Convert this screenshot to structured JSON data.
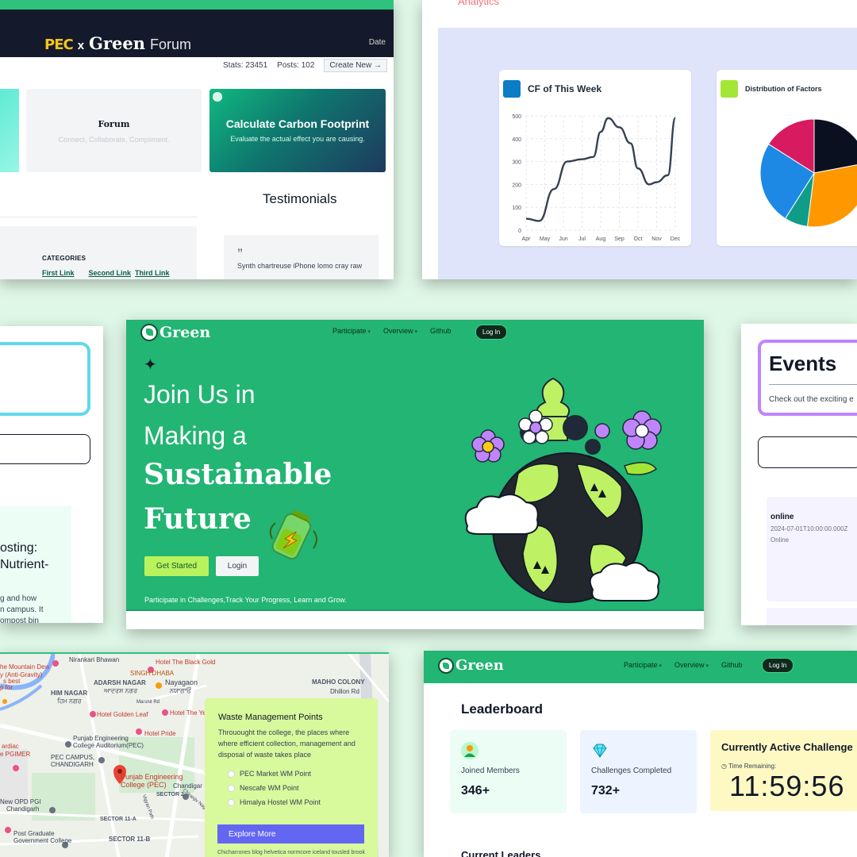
{
  "forum": {
    "brand_pec": "PEC",
    "brand_x": "x",
    "brand_green": "Green",
    "brand_forum": "Forum",
    "date_label": "Date",
    "stats": "Stats: 23451",
    "posts": "Posts: 102",
    "create_new": "Create New →",
    "tile_forum_title": "Forum",
    "tile_forum_sub": "Connect, Collaborate, Compliment.",
    "tile_cf_title": "Calculate Carbon Footprint",
    "tile_cf_sub": "Evaluate the actual effect you are causing.",
    "testimonials": "Testimonials",
    "quote_mark": "”",
    "quote_text": "Synth chartreuse iPhone lomo cray raw",
    "categories_title": "CATEGORIES",
    "links": [
      "First Link",
      "Second Link",
      "Third Link"
    ]
  },
  "analytics": {
    "title": "Analytics",
    "cf_title": "CF of This Week",
    "dist_title": "Distribution of Factors",
    "colors": {
      "cf_square": "#0b7dc6",
      "dist_square": "#a3e635"
    }
  },
  "chart_data": [
    {
      "type": "line",
      "title": "CF of This Week",
      "categories": [
        "Apr",
        "May",
        "Jun",
        "Jul",
        "Aug",
        "Sep",
        "Oct",
        "Nov",
        "Dec"
      ],
      "x_points": [
        4,
        4.7,
        5.5,
        6.2,
        7.0,
        7.6,
        8.0,
        8.4,
        9.0,
        9.6,
        10.0,
        10.6,
        11.0,
        11.6,
        12.0
      ],
      "values": [
        50,
        40,
        180,
        300,
        310,
        320,
        430,
        490,
        450,
        380,
        270,
        200,
        210,
        240,
        490
      ],
      "ylim": [
        0,
        500
      ],
      "yticks": [
        0,
        100,
        200,
        300,
        400,
        500
      ],
      "grid": true
    },
    {
      "type": "pie",
      "title": "Distribution of Factors",
      "values": [
        22,
        30,
        7,
        25,
        16
      ],
      "colors": [
        "#0b1020",
        "#ff9800",
        "#0f9d8a",
        "#1e88e5",
        "#d81b60"
      ]
    }
  ],
  "leftmid": {
    "article_title_1": "osting:",
    "article_title_2": "Nutrient-",
    "article_text_1": "g and how",
    "article_text_2": "n campus. It",
    "article_text_3": "ompost bin"
  },
  "hero": {
    "logo_text": "Green",
    "menu": [
      "Participate",
      "Overview",
      "Github"
    ],
    "login": "Log In",
    "line1": "Join Us in",
    "line2": "Making a",
    "line3": "Sustainable",
    "line4": "Future",
    "get_started": "Get Started",
    "login_button": "Login",
    "tagline": "Participate in Challenges,Track Your Progress, Learn and Grow."
  },
  "events": {
    "title": "Events",
    "subtitle": "Check out the exciting e",
    "item_title": "online",
    "item_date": "2024-07-01T10:00:00.000Z",
    "item_mode": "Online"
  },
  "map": {
    "labels": {
      "mountain": "he Mountain Dew",
      "antigravity": "y (Anti-Gravity)",
      "best": "s best",
      "pgimer_top": "p for",
      "nirankari": "Nirankari Bhawan",
      "blackgold": "Hotel The Black Gold",
      "singh": "SINGH DHABA",
      "adarsh": "ADARSH NAGAR",
      "adarsh_pa": "ਆਦਰਸ਼ ਨਗਰ",
      "nayagaon": "Nayagaon",
      "nayagaon_pa": "ਨਯਾਗਾਓਂ",
      "madho": "MADHO COLONY",
      "dhillon": "Dhillon Rd",
      "him": "HIM NAGAR",
      "him_pa": "ਹਿਮ ਨਗਰ",
      "marshit": "Marshit Rd",
      "golden": "Hotel Golden Leaf",
      "yell": "Hotel The Yell",
      "pride": "Hotel Pride",
      "auditorium1": "Punjab Engineering",
      "auditorium2": "College Auditorium(PEC)",
      "cardiac": "ardiac",
      "pgimer": "e PGIMER",
      "campus1": "PEC CAMPUS,",
      "campus2": "CHANDIGARH",
      "pec1": "Punjab Engineering",
      "pec2": "College (PEC)",
      "chandigar": "Chandigar",
      "sector2": "SECTOR 2",
      "opd1": "New OPD PGI",
      "opd2": "Chandigarh",
      "sector11a": "SECTOR 11-A",
      "sector11b": "SECTOR 11-B",
      "postgrad1": "Post Graduate",
      "postgrad2": "Government College",
      "vigyan": "Vigyan Path",
      "chiranjiv": "Chiranjiv Nagar"
    },
    "panel_title": "Waste Management Points",
    "panel_desc": "Throuought the college, the places where where efficient collection, management and disposal of waste takes place",
    "points": [
      "PEC Market WM Point",
      "Nescafe WM Point",
      "Himalya Hostel WM Point"
    ],
    "explore": "Explore More",
    "foot": "Chicharrones blog helvetica normcore iceland tousled brook"
  },
  "leader": {
    "logo_text": "Green",
    "menu": [
      "Participate",
      "Overview",
      "Github"
    ],
    "login": "Log In",
    "title": "Leaderboard",
    "joined_label": "Joined Members",
    "joined_value": "346+",
    "completed_label": "Challenges Completed",
    "completed_value": "732+",
    "active_title": "Currently Active Challenge",
    "time_label": "Time Remaining:",
    "time_value": "11:59:56",
    "current_leaders": "Current Leaders"
  }
}
